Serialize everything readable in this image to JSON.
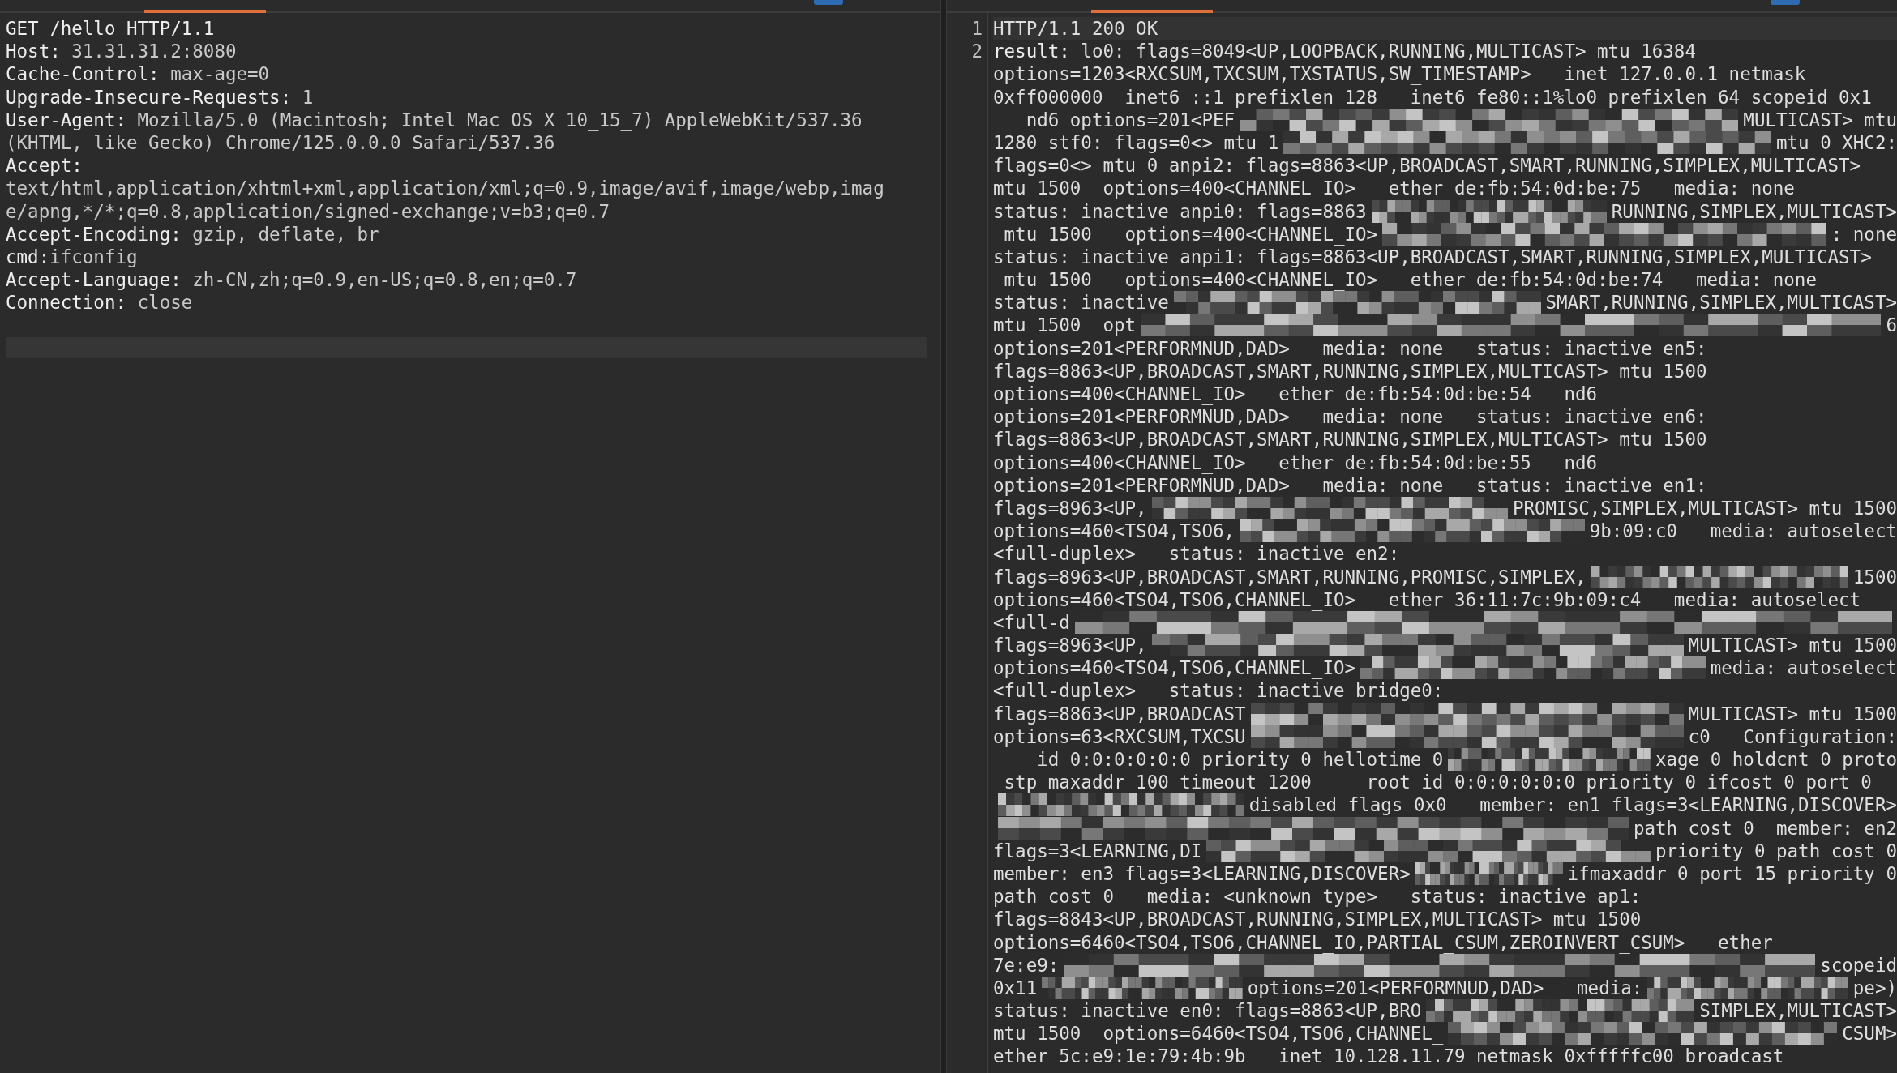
{
  "request": {
    "tabs": [
      {
        "selected": true
      }
    ],
    "lines": [
      [
        {
          "kind": "key",
          "text": "GET /hello HTTP/1.1"
        }
      ],
      [
        {
          "kind": "key",
          "text": "Host:"
        },
        {
          "kind": "value",
          "text": " 31.31.31.2:8080"
        }
      ],
      [
        {
          "kind": "key",
          "text": "Cache-Control:"
        },
        {
          "kind": "value",
          "text": " max-age=0"
        }
      ],
      [
        {
          "kind": "key",
          "text": "Upgrade-Insecure-Requests:"
        },
        {
          "kind": "value",
          "text": " 1"
        }
      ],
      [
        {
          "kind": "key",
          "text": "User-Agent:"
        },
        {
          "kind": "value",
          "text": " Mozilla/5.0 (Macintosh; Intel Mac OS X 10_15_7) AppleWebKit/537.36"
        }
      ],
      [
        {
          "kind": "value",
          "text": "(KHTML, like Gecko) Chrome/125.0.0.0 Safari/537.36"
        }
      ],
      [
        {
          "kind": "key",
          "text": "Accept:"
        }
      ],
      [
        {
          "kind": "value",
          "text": "text/html,application/xhtml+xml,application/xml;q=0.9,image/avif,image/webp,imag"
        }
      ],
      [
        {
          "kind": "value",
          "text": "e/apng,*/*;q=0.8,application/signed-exchange;v=b3;q=0.7"
        }
      ],
      [
        {
          "kind": "key",
          "text": "Accept-Encoding:"
        },
        {
          "kind": "value",
          "text": " gzip, deflate, br"
        }
      ],
      [
        {
          "kind": "key",
          "text": "cmd:"
        },
        {
          "kind": "value",
          "text": "ifconfig"
        }
      ],
      [
        {
          "kind": "key",
          "text": "Accept-Language:"
        },
        {
          "kind": "value",
          "text": " zh-CN,zh;q=0.9,en-US;q=0.8,en;q=0.7"
        }
      ],
      [
        {
          "kind": "key",
          "text": "Connection:"
        },
        {
          "kind": "value",
          "text": " close"
        }
      ],
      [
        {
          "kind": "cursor"
        }
      ]
    ]
  },
  "response": {
    "tabs": [
      {
        "selected": true
      }
    ],
    "line_numbers": [
      "1",
      "2"
    ],
    "lines": [
      [
        {
          "kind": "text",
          "text": "HTTP/1.1 200 OK"
        }
      ],
      [
        {
          "kind": "key",
          "text": "result:"
        },
        {
          "kind": "text",
          "text": " lo0: flags=8049<UP,LOOPBACK,RUNNING,MULTICAST> mtu 16384"
        }
      ],
      [
        {
          "kind": "text",
          "text": "options=1203<RXCSUM,TXCSUM,TXSTATUS,SW_TIMESTAMP>   inet 127.0.0.1 netmask"
        }
      ],
      [
        {
          "kind": "text",
          "text": "0xff000000  inet6 ::1 prefixlen 128   inet6 fe80::1%lo0 prefixlen 64 scopeid 0x1"
        }
      ],
      [
        {
          "kind": "text",
          "text": "   nd6 options=201<PEF"
        },
        {
          "kind": "mosaic"
        },
        {
          "kind": "text",
          "text": "MULTICAST> mtu"
        }
      ],
      [
        {
          "kind": "text",
          "text": "1280 stf0: flags=0<> mtu 1"
        },
        {
          "kind": "mosaic"
        },
        {
          "kind": "text",
          "text": "mtu 0 XHC2:"
        }
      ],
      [
        {
          "kind": "text",
          "text": "flags=0<> mtu 0 anpi2: flags=8863<UP,BROADCAST,SMART,RUNNING,SIMPLEX,MULTICAST>"
        }
      ],
      [
        {
          "kind": "text",
          "text": "mtu 1500  options=400<CHANNEL_IO>   ether de:fb:54:0d:be:75   media: none"
        }
      ],
      [
        {
          "kind": "text",
          "text": "status: inactive anpi0: flags=8863"
        },
        {
          "kind": "mosaic"
        },
        {
          "kind": "text",
          "text": "RUNNING,SIMPLEX,MULTICAST>"
        }
      ],
      [
        {
          "kind": "text",
          "text": " mtu 1500   options=400<CHANNEL_IO>"
        },
        {
          "kind": "mosaic"
        },
        {
          "kind": "text",
          "text": ": none"
        }
      ],
      [
        {
          "kind": "text",
          "text": "status: inactive anpi1: flags=8863<UP,BROADCAST,SMART,RUNNING,SIMPLEX,MULTICAST>"
        }
      ],
      [
        {
          "kind": "text",
          "text": " mtu 1500   options=400<CHANNEL_IO>   ether de:fb:54:0d:be:74   media: none"
        }
      ],
      [
        {
          "kind": "text",
          "text": "status: inactive"
        },
        {
          "kind": "mosaic"
        },
        {
          "kind": "text",
          "text": "SMART,RUNNING,SIMPLEX,MULTICAST>"
        }
      ],
      [
        {
          "kind": "text",
          "text": "mtu 1500  opt"
        },
        {
          "kind": "mosaic"
        },
        {
          "kind": "text",
          "text": "6"
        }
      ],
      [
        {
          "kind": "text",
          "text": "options=201<PERFORMNUD,DAD>   media: none   status: inactive en5:"
        }
      ],
      [
        {
          "kind": "text",
          "text": "flags=8863<UP,BROADCAST,SMART,RUNNING,SIMPLEX,MULTICAST> mtu 1500"
        }
      ],
      [
        {
          "kind": "text",
          "text": "options=400<CHANNEL_IO>   ether de:fb:54:0d:be:54   nd6"
        }
      ],
      [
        {
          "kind": "text",
          "text": "options=201<PERFORMNUD,DAD>   media: none   status: inactive en6:"
        }
      ],
      [
        {
          "kind": "text",
          "text": "flags=8863<UP,BROADCAST,SMART,RUNNING,SIMPLEX,MULTICAST> mtu 1500"
        }
      ],
      [
        {
          "kind": "text",
          "text": "options=400<CHANNEL_IO>   ether de:fb:54:0d:be:55   nd6"
        }
      ],
      [
        {
          "kind": "text",
          "text": "options=201<PERFORMNUD,DAD>   media: none   status: inactive en1:"
        }
      ],
      [
        {
          "kind": "text",
          "text": "flags=8963<UP,"
        },
        {
          "kind": "mosaic"
        },
        {
          "kind": "text",
          "text": "PROMISC,SIMPLEX,MULTICAST> mtu 1500"
        }
      ],
      [
        {
          "kind": "text",
          "text": "options=460<TSO4,TSO6,"
        },
        {
          "kind": "mosaic"
        },
        {
          "kind": "text",
          "text": "9b:09:c0   media: autoselect"
        }
      ],
      [
        {
          "kind": "text",
          "text": "<full-duplex>   status: inactive en2:"
        }
      ],
      [
        {
          "kind": "text",
          "text": "flags=8963<UP,BROADCAST,SMART,RUNNING,PROMISC,SIMPLEX,"
        },
        {
          "kind": "mosaic"
        },
        {
          "kind": "text",
          "text": "1500"
        }
      ],
      [
        {
          "kind": "text",
          "text": "options=460<TSO4,TSO6,CHANNEL_IO>   ether 36:11:7c:9b:09:c4   media: autoselect"
        }
      ],
      [
        {
          "kind": "text",
          "text": "<full-d"
        },
        {
          "kind": "mosaic"
        }
      ],
      [
        {
          "kind": "text",
          "text": "flags=8963<UP,"
        },
        {
          "kind": "mosaic"
        },
        {
          "kind": "text",
          "text": "MULTICAST> mtu 1500"
        }
      ],
      [
        {
          "kind": "text",
          "text": "options=460<TSO4,TSO6,CHANNEL_IO>"
        },
        {
          "kind": "mosaic"
        },
        {
          "kind": "text",
          "text": "media: autoselect"
        }
      ],
      [
        {
          "kind": "text",
          "text": "<full-duplex>   status: inactive bridge0:"
        }
      ],
      [
        {
          "kind": "text",
          "text": "flags=8863<UP,BROADCAST"
        },
        {
          "kind": "mosaic"
        },
        {
          "kind": "text",
          "text": "MULTICAST> mtu 1500"
        }
      ],
      [
        {
          "kind": "text",
          "text": "options=63<RXCSUM,TXCSU"
        },
        {
          "kind": "mosaic"
        },
        {
          "kind": "text",
          "text": "c0   Configuration:"
        }
      ],
      [
        {
          "kind": "text",
          "text": "    id 0:0:0:0:0:0 priority 0 hellotime 0"
        },
        {
          "kind": "mosaic"
        },
        {
          "kind": "text",
          "text": "xage 0 holdcnt 0 proto"
        }
      ],
      [
        {
          "kind": "text",
          "text": " stp maxaddr 100 timeout 1200     root id 0:0:0:0:0:0 priority 0 ifcost 0 port 0"
        }
      ],
      [
        {
          "kind": "mosaic"
        },
        {
          "kind": "text",
          "text": "disabled flags 0x0   member: en1 flags=3<LEARNING,DISCOVER>"
        }
      ],
      [
        {
          "kind": "mosaic"
        },
        {
          "kind": "text",
          "text": "path cost 0  member: en2"
        }
      ],
      [
        {
          "kind": "text",
          "text": "flags=3<LEARNING,DI"
        },
        {
          "kind": "mosaic"
        },
        {
          "kind": "text",
          "text": "priority 0 path cost 0"
        }
      ],
      [
        {
          "kind": "text",
          "text": "member: en3 flags=3<LEARNING,DISCOVER>"
        },
        {
          "kind": "mosaic"
        },
        {
          "kind": "text",
          "text": "ifmaxaddr 0 port 15 priority 0"
        }
      ],
      [
        {
          "kind": "text",
          "text": "path cost 0   media: <unknown type>   status: inactive ap1:"
        }
      ],
      [
        {
          "kind": "text",
          "text": "flags=8843<UP,BROADCAST,RUNNING,SIMPLEX,MULTICAST> mtu 1500"
        }
      ],
      [
        {
          "kind": "text",
          "text": "options=6460<TSO4,TSO6,CHANNEL_IO,PARTIAL_CSUM,ZEROINVERT_CSUM>   ether"
        }
      ],
      [
        {
          "kind": "text",
          "text": "7e:e9:"
        },
        {
          "kind": "mosaic"
        },
        {
          "kind": "text",
          "text": "scopeid"
        }
      ],
      [
        {
          "kind": "text",
          "text": "0x11"
        },
        {
          "kind": "mosaic"
        },
        {
          "kind": "text",
          "text": "options=201<PERFORMNUD,DAD>   media:"
        },
        {
          "kind": "mosaic"
        },
        {
          "kind": "text",
          "text": "pe>)"
        }
      ],
      [
        {
          "kind": "text",
          "text": "status: inactive en0: flags=8863<UP,BRO"
        },
        {
          "kind": "mosaic"
        },
        {
          "kind": "text",
          "text": "SIMPLEX,MULTICAST>"
        }
      ],
      [
        {
          "kind": "text",
          "text": "mtu 1500  options=6460<TSO4,TSO6,CHANNEL_"
        },
        {
          "kind": "mosaic"
        },
        {
          "kind": "text",
          "text": "CSUM>"
        }
      ],
      [
        {
          "kind": "text",
          "text": "ether 5c:e9:1e:79:4b:9b   inet 10.128.11.79 netmask 0xfffffc00 broadcast"
        }
      ]
    ]
  }
}
